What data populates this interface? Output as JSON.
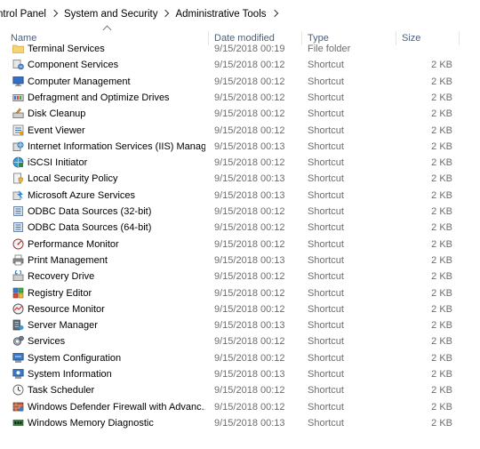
{
  "breadcrumb": {
    "parts": [
      "ntrol Panel",
      "System and Security",
      "Administrative Tools"
    ]
  },
  "columns": {
    "name": "Name",
    "date": "Date modified",
    "type": "Type",
    "size": "Size"
  },
  "files": [
    {
      "name": "Terminal Services",
      "date": "9/15/2018 00:19",
      "type": "File folder",
      "size": "",
      "icon": "folder-icon"
    },
    {
      "name": "Component Services",
      "date": "9/15/2018 00:12",
      "type": "Shortcut",
      "size": "2 KB",
      "icon": "component-services-icon"
    },
    {
      "name": "Computer Management",
      "date": "9/15/2018 00:12",
      "type": "Shortcut",
      "size": "2 KB",
      "icon": "computer-management-icon"
    },
    {
      "name": "Defragment and Optimize Drives",
      "date": "9/15/2018 00:12",
      "type": "Shortcut",
      "size": "2 KB",
      "icon": "defragment-icon"
    },
    {
      "name": "Disk Cleanup",
      "date": "9/15/2018 00:12",
      "type": "Shortcut",
      "size": "2 KB",
      "icon": "disk-cleanup-icon"
    },
    {
      "name": "Event Viewer",
      "date": "9/15/2018 00:12",
      "type": "Shortcut",
      "size": "2 KB",
      "icon": "event-viewer-icon"
    },
    {
      "name": "Internet Information Services (IIS) Manager",
      "date": "9/15/2018 00:13",
      "type": "Shortcut",
      "size": "2 KB",
      "icon": "iis-manager-icon"
    },
    {
      "name": "iSCSI Initiator",
      "date": "9/15/2018 00:12",
      "type": "Shortcut",
      "size": "2 KB",
      "icon": "iscsi-icon"
    },
    {
      "name": "Local Security Policy",
      "date": "9/15/2018 00:13",
      "type": "Shortcut",
      "size": "2 KB",
      "icon": "security-policy-icon"
    },
    {
      "name": "Microsoft Azure Services",
      "date": "9/15/2018 00:13",
      "type": "Shortcut",
      "size": "2 KB",
      "icon": "azure-icon"
    },
    {
      "name": "ODBC Data Sources (32-bit)",
      "date": "9/15/2018 00:12",
      "type": "Shortcut",
      "size": "2 KB",
      "icon": "odbc-icon"
    },
    {
      "name": "ODBC Data Sources (64-bit)",
      "date": "9/15/2018 00:12",
      "type": "Shortcut",
      "size": "2 KB",
      "icon": "odbc-icon"
    },
    {
      "name": "Performance Monitor",
      "date": "9/15/2018 00:12",
      "type": "Shortcut",
      "size": "2 KB",
      "icon": "performance-monitor-icon"
    },
    {
      "name": "Print Management",
      "date": "9/15/2018 00:13",
      "type": "Shortcut",
      "size": "2 KB",
      "icon": "printer-icon"
    },
    {
      "name": "Recovery Drive",
      "date": "9/15/2018 00:12",
      "type": "Shortcut",
      "size": "2 KB",
      "icon": "recovery-drive-icon"
    },
    {
      "name": "Registry Editor",
      "date": "9/15/2018 00:12",
      "type": "Shortcut",
      "size": "2 KB",
      "icon": "registry-editor-icon"
    },
    {
      "name": "Resource Monitor",
      "date": "9/15/2018 00:12",
      "type": "Shortcut",
      "size": "2 KB",
      "icon": "resource-monitor-icon"
    },
    {
      "name": "Server Manager",
      "date": "9/15/2018 00:13",
      "type": "Shortcut",
      "size": "2 KB",
      "icon": "server-manager-icon"
    },
    {
      "name": "Services",
      "date": "9/15/2018 00:12",
      "type": "Shortcut",
      "size": "2 KB",
      "icon": "services-icon"
    },
    {
      "name": "System Configuration",
      "date": "9/15/2018 00:12",
      "type": "Shortcut",
      "size": "2 KB",
      "icon": "system-configuration-icon"
    },
    {
      "name": "System Information",
      "date": "9/15/2018 00:13",
      "type": "Shortcut",
      "size": "2 KB",
      "icon": "system-information-icon"
    },
    {
      "name": "Task Scheduler",
      "date": "9/15/2018 00:12",
      "type": "Shortcut",
      "size": "2 KB",
      "icon": "task-scheduler-icon"
    },
    {
      "name": "Windows Defender Firewall with Advanc...",
      "date": "9/15/2018 00:12",
      "type": "Shortcut",
      "size": "2 KB",
      "icon": "firewall-icon"
    },
    {
      "name": "Windows Memory Diagnostic",
      "date": "9/15/2018 00:13",
      "type": "Shortcut",
      "size": "2 KB",
      "icon": "memory-diagnostic-icon"
    }
  ]
}
